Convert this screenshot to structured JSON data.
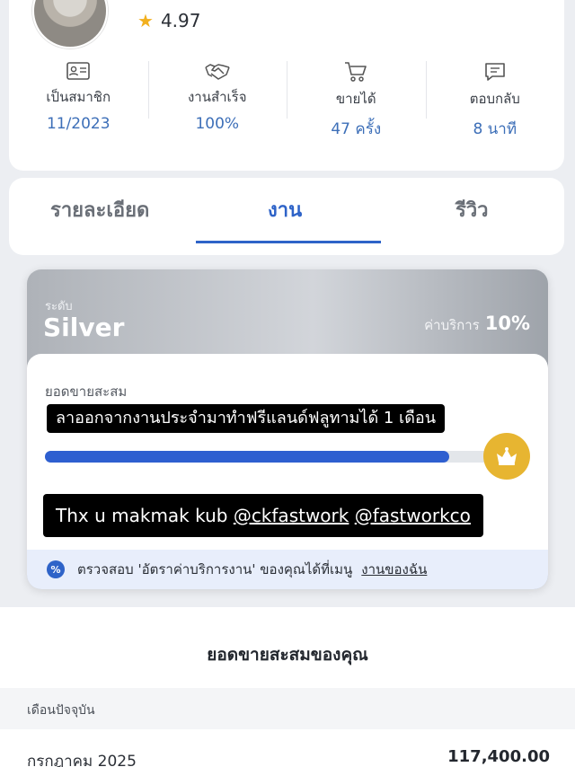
{
  "profile": {
    "rating": "4.97",
    "stats": [
      {
        "label": "เป็นสมาชิก",
        "value": "11/2023",
        "icon": "member-card-icon"
      },
      {
        "label": "งานสำเร็จ",
        "value": "100%",
        "icon": "handshake-icon"
      },
      {
        "label": "ขายได้",
        "value": "47 ครั้ง",
        "icon": "cart-icon"
      },
      {
        "label": "ตอบกลับ",
        "value": "8 นาที",
        "icon": "chat-icon"
      }
    ]
  },
  "tabs": [
    {
      "label": "รายละเอียด",
      "active": false
    },
    {
      "label": "งาน",
      "active": true
    },
    {
      "label": "รีวิว",
      "active": false
    }
  ],
  "tier": {
    "level_label": "ระดับ",
    "name": "Silver",
    "fee_label": "ค่าบริการ",
    "fee_value": "10%",
    "sales_title": "ยอดขายสะสม",
    "progress": 0.9,
    "caption_top": "ลาออกจากงานประจำมาทำฟรีแลนด์ฟลูทามได้ 1 เดือน",
    "caption_bottom_text": "Thx u makmak kub ",
    "caption_mention_1": "@ckfastwork",
    "caption_mention_2": "@fastworkco",
    "notice_text": "ตรวจสอบ 'อัตราค่าบริการงาน' ของคุณได้ที่เมนู",
    "notice_link": "งานของฉัน"
  },
  "summary": {
    "title": "ยอดขายสะสมของคุณ",
    "section_label": "เดือนปัจจุบัน",
    "rows": [
      {
        "month": "กรกฎาคม 2025",
        "amount": "117,400.00"
      }
    ]
  },
  "colors": {
    "accent": "#2e63c8",
    "star": "#f2b01e",
    "crown_badge": "#e7b531"
  }
}
